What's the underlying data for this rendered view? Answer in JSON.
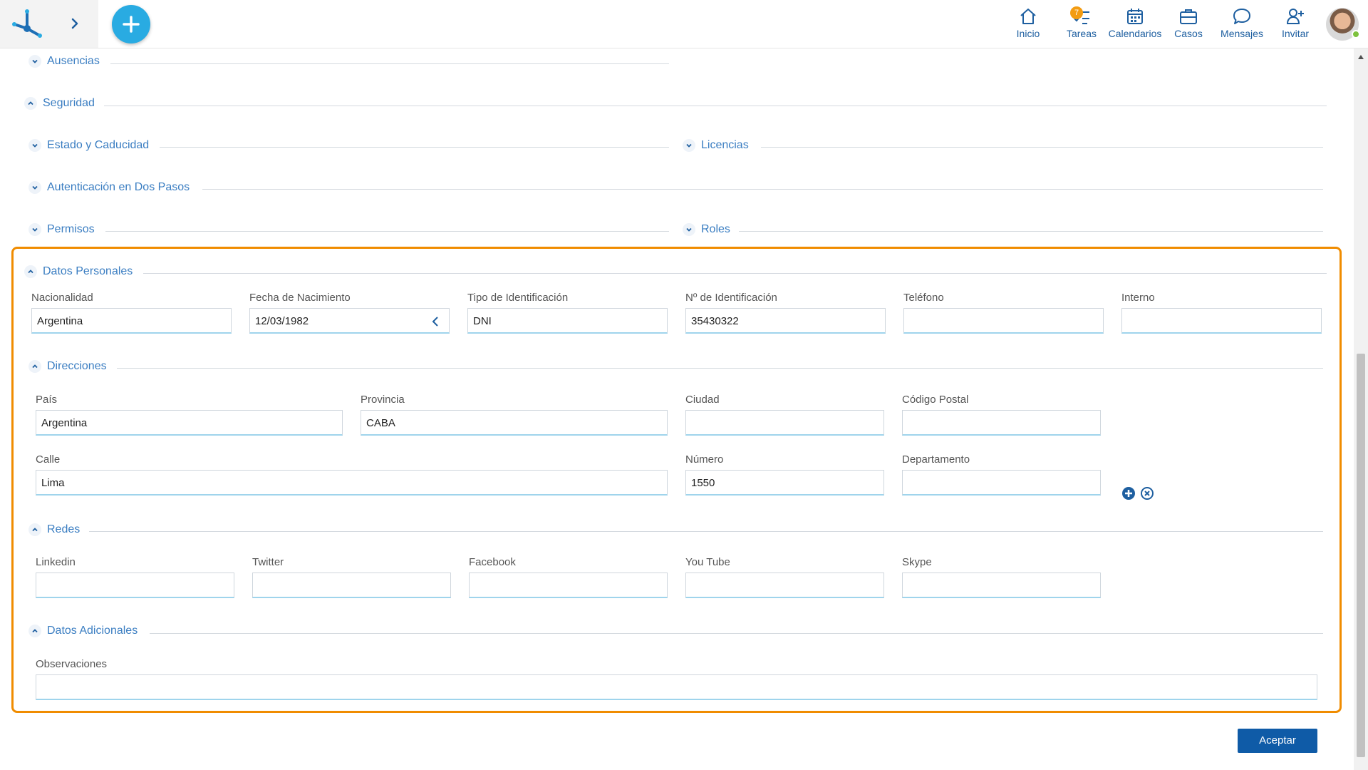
{
  "topbar": {
    "nav": [
      {
        "label": "Inicio",
        "icon": "home-icon"
      },
      {
        "label": "Tareas",
        "icon": "tasks-icon",
        "badge": "7"
      },
      {
        "label": "Calendarios",
        "icon": "calendar-icon"
      },
      {
        "label": "Casos",
        "icon": "briefcase-icon"
      },
      {
        "label": "Mensajes",
        "icon": "chat-icon"
      },
      {
        "label": "Invitar",
        "icon": "add-user-icon"
      }
    ]
  },
  "sections": {
    "ausencias": "Ausencias",
    "seguridad": "Seguridad",
    "estado": "Estado y Caducidad",
    "licencias": "Licencias",
    "autenticacion": "Autenticación en Dos Pasos",
    "permisos": "Permisos",
    "roles": "Roles",
    "datos_personales": "Datos Personales",
    "direcciones": "Direcciones",
    "redes": "Redes",
    "datos_adicionales": "Datos Adicionales"
  },
  "personal": {
    "nacionalidad": {
      "label": "Nacionalidad",
      "value": "Argentina"
    },
    "fecha": {
      "label": "Fecha de Nacimiento",
      "value": "12/03/1982"
    },
    "tipo_id": {
      "label": "Tipo de Identificación",
      "value": "DNI"
    },
    "nro_id": {
      "label": "Nº de Identificación",
      "value": "35430322"
    },
    "telefono": {
      "label": "Teléfono",
      "value": ""
    },
    "interno": {
      "label": "Interno",
      "value": ""
    }
  },
  "address": {
    "pais": {
      "label": "País",
      "value": "Argentina"
    },
    "provincia": {
      "label": "Provincia",
      "value": "CABA"
    },
    "ciudad": {
      "label": "Ciudad",
      "value": ""
    },
    "codigo_postal": {
      "label": "Código Postal",
      "value": ""
    },
    "calle": {
      "label": "Calle",
      "value": "Lima"
    },
    "numero": {
      "label": "Número",
      "value": "1550"
    },
    "departamento": {
      "label": "Departamento",
      "value": ""
    }
  },
  "networks": {
    "linkedin": {
      "label": "Linkedin",
      "value": ""
    },
    "twitter": {
      "label": "Twitter",
      "value": ""
    },
    "facebook": {
      "label": "Facebook",
      "value": ""
    },
    "youtube": {
      "label": "You Tube",
      "value": ""
    },
    "skype": {
      "label": "Skype",
      "value": ""
    }
  },
  "extra": {
    "observaciones": {
      "label": "Observaciones",
      "value": ""
    }
  },
  "actions": {
    "accept": "Aceptar"
  },
  "colors": {
    "accent": "#29abe2",
    "link": "#3b7ec2",
    "highlight": "#f08c00",
    "primary_button": "#0f5ba7"
  }
}
